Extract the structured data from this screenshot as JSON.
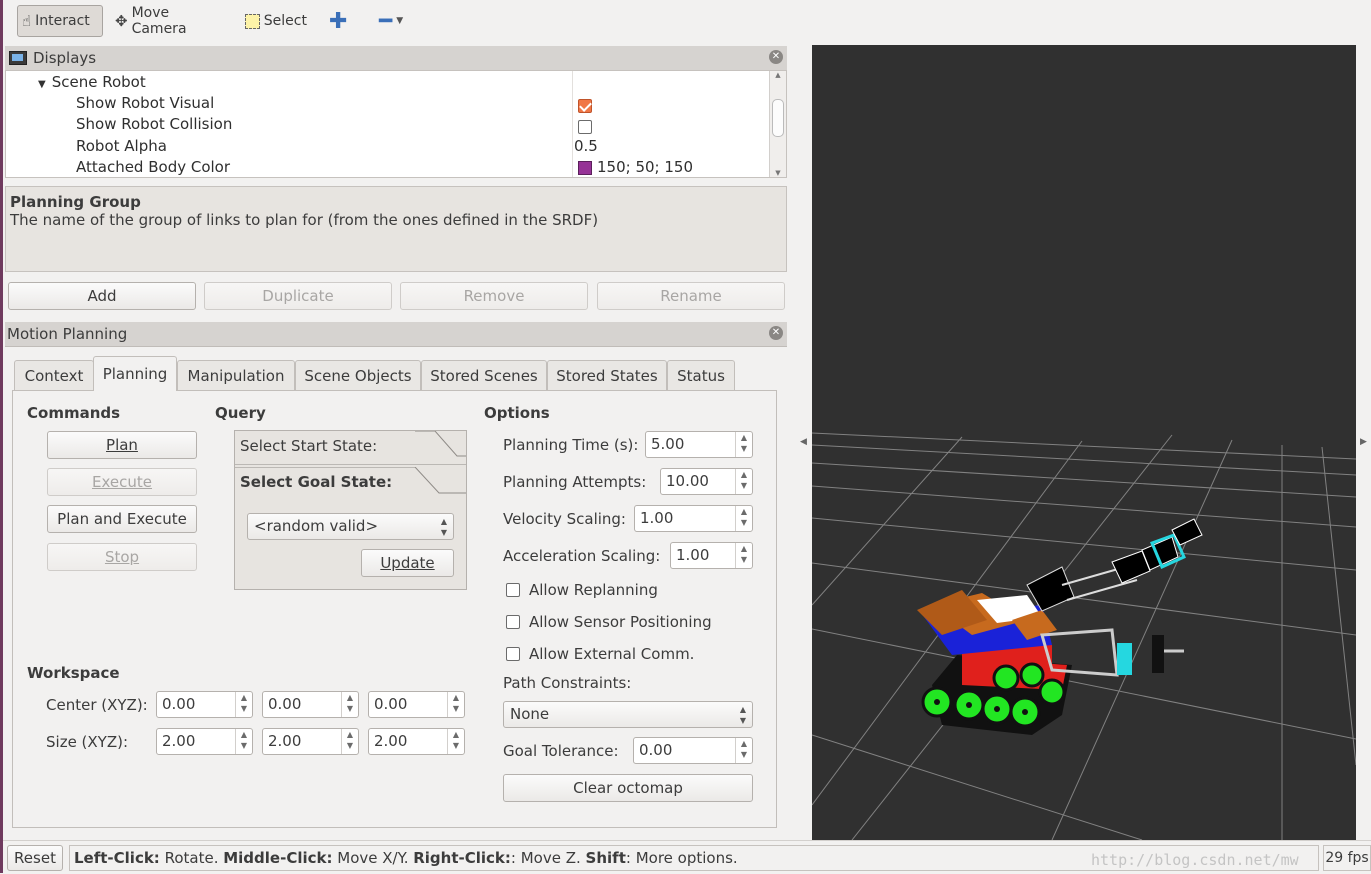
{
  "toolbar": {
    "interact": "Interact",
    "move_camera": "Move Camera",
    "select": "Select"
  },
  "displays": {
    "title": "Displays",
    "rows": [
      {
        "label": "Scene Robot",
        "value": ""
      },
      {
        "label": "Show Robot Visual",
        "value": "checked"
      },
      {
        "label": "Show Robot Collision",
        "value": "unchecked"
      },
      {
        "label": "Robot Alpha",
        "value": "0.5"
      },
      {
        "label": "Attached Body Color",
        "value": "150; 50; 150"
      }
    ],
    "attached_color": "#963296",
    "description_title": "Planning Group",
    "description_text": "The name of the group of links to plan for (from the ones defined in the SRDF)",
    "buttons": {
      "add": "Add",
      "duplicate": "Duplicate",
      "remove": "Remove",
      "rename": "Rename"
    }
  },
  "motion_planning": {
    "title": "Motion Planning",
    "tabs": [
      "Context",
      "Planning",
      "Manipulation",
      "Scene Objects",
      "Stored Scenes",
      "Stored States",
      "Status"
    ],
    "active_tab": "Planning",
    "commands": {
      "title": "Commands",
      "plan": "Plan",
      "execute": "Execute",
      "plan_and_execute": "Plan and Execute",
      "stop": "Stop"
    },
    "query": {
      "title": "Query",
      "start_state": "Select Start State:",
      "goal_state": "Select Goal State:",
      "goal_value": "<random valid>",
      "update": "Update"
    },
    "options": {
      "title": "Options",
      "planning_time_label": "Planning Time (s):",
      "planning_time": "5.00",
      "planning_attempts_label": "Planning Attempts:",
      "planning_attempts": "10.00",
      "velocity_label": "Velocity Scaling:",
      "velocity": "1.00",
      "accel_label": "Acceleration Scaling:",
      "accel": "1.00",
      "allow_replanning": "Allow Replanning",
      "allow_sensor": "Allow Sensor Positioning",
      "allow_external": "Allow External Comm.",
      "path_constraints_label": "Path Constraints:",
      "path_constraints": "None",
      "goal_tolerance_label": "Goal Tolerance:",
      "goal_tolerance": "0.00",
      "clear_octomap": "Clear octomap"
    },
    "workspace": {
      "title": "Workspace",
      "center_label": "Center (XYZ):",
      "center": [
        "0.00",
        "0.00",
        "0.00"
      ],
      "size_label": "Size (XYZ):",
      "size": [
        "2.00",
        "2.00",
        "2.00"
      ]
    }
  },
  "status_bar": {
    "reset": "Reset",
    "left_click_key": "Left-Click:",
    "left_click_val": " Rotate. ",
    "middle_click_key": "Middle-Click:",
    "middle_click_val": " Move X/Y. ",
    "right_click_key": "Right-Click:",
    "right_click_val": ": Move Z. ",
    "shift_key": "Shift",
    "shift_val": ": More options.",
    "watermark": "http://blog.csdn.net/mw",
    "fps": "29 fps"
  },
  "colors": {
    "viewport_bg": "#303030",
    "accent_check": "#f07746",
    "wheel": "#22e622",
    "body_red": "#e0201c",
    "body_blue": "#1a22d8"
  }
}
